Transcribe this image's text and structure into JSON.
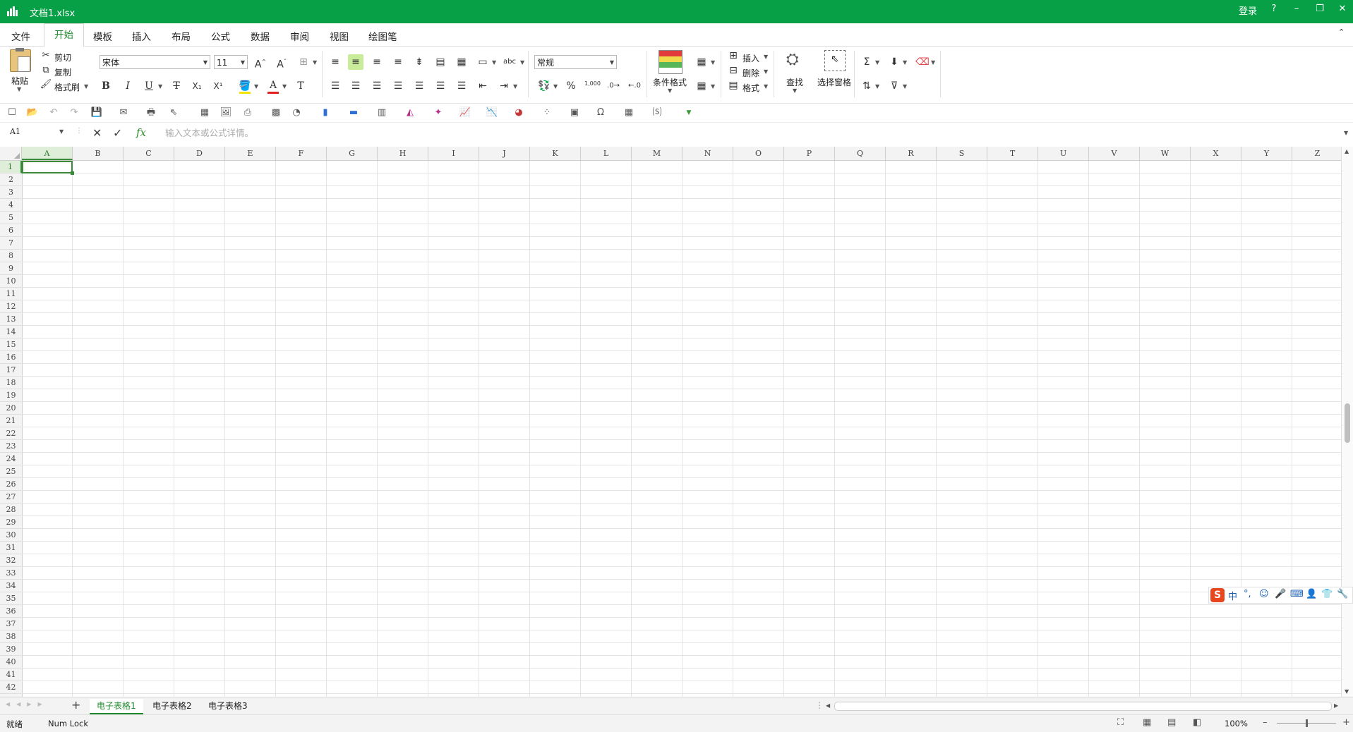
{
  "window": {
    "title": "文档1.xlsx",
    "login": "登录",
    "help": "?",
    "minimize": "–",
    "restore": "❐",
    "close": "✕"
  },
  "menu": {
    "tabs": [
      "文件",
      "开始",
      "模板",
      "插入",
      "布局",
      "公式",
      "数据",
      "审阅",
      "视图",
      "绘图笔"
    ],
    "active": "开始",
    "collapse": "⌃"
  },
  "ribbon": {
    "paste": "粘贴",
    "cut": "剪切",
    "copy": "复制",
    "format_painter": "格式刷",
    "font_name": "宋体",
    "font_size": "11",
    "number_format": "常规",
    "percent": "%",
    "thousands": "1,000",
    "conditional_format": "条件格式",
    "insert": "插入",
    "delete": "删除",
    "format": "格式",
    "find": "查找",
    "selection_pane": "选择窗格",
    "bold": "B",
    "italic": "I",
    "underline": "U",
    "strike": "T",
    "sub": "X₁",
    "sup": "X¹",
    "clear": "T"
  },
  "formula_bar": {
    "cell_ref": "A1",
    "placeholder": "输入文本或公式详情。",
    "fx": "fx"
  },
  "columns": [
    "A",
    "B",
    "C",
    "D",
    "E",
    "F",
    "G",
    "H",
    "I",
    "J",
    "K",
    "L",
    "M",
    "N",
    "O",
    "P",
    "Q",
    "R",
    "S",
    "T",
    "U",
    "V",
    "W",
    "X",
    "Y",
    "Z"
  ],
  "rows": [
    "1",
    "2",
    "3",
    "4",
    "5",
    "6",
    "7",
    "8",
    "9",
    "10",
    "11",
    "12",
    "13",
    "14",
    "15",
    "16",
    "17",
    "18",
    "19",
    "20",
    "21",
    "22",
    "23",
    "24",
    "25",
    "26",
    "27",
    "28",
    "29",
    "30",
    "31",
    "32",
    "33",
    "34",
    "35",
    "36",
    "37",
    "38",
    "39",
    "40",
    "41",
    "42"
  ],
  "sheets": {
    "add": "+",
    "tabs": [
      "电子表格1",
      "电子表格2",
      "电子表格3"
    ],
    "active": "电子表格1"
  },
  "status": {
    "ready": "就绪",
    "numlock": "Num Lock",
    "zoom": "100%",
    "zoom_out": "–",
    "zoom_in": "+"
  },
  "ime": {
    "logo": "S",
    "items": [
      "中",
      "°,",
      "☺",
      "🎤",
      "⌨",
      "👤",
      "👕",
      "🔧"
    ]
  },
  "colors": {
    "brand": "#07a047",
    "accent": "#1f8a2d"
  }
}
